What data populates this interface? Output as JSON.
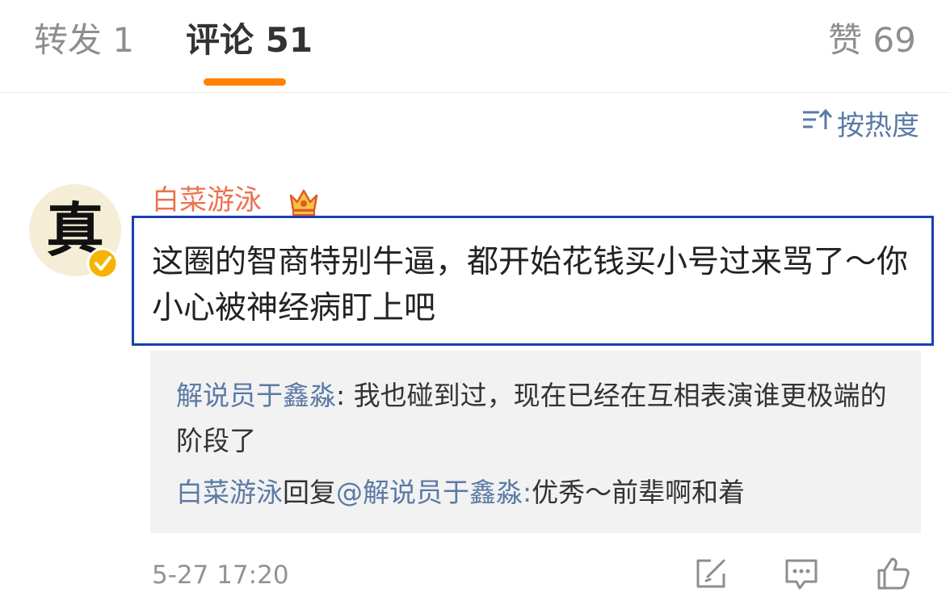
{
  "tabs": {
    "repost": "转发 1",
    "comments": "评论 51",
    "likes": "赞 69"
  },
  "sort": {
    "label": "按热度",
    "icon": "sort-icon"
  },
  "comment": {
    "avatar_text": "真",
    "username": "白菜游泳",
    "text": "这圈的智商特别牛逼，都开始花钱买小号过来骂了～你小心被神经病盯上吧",
    "timestamp": "5-27 17:20",
    "badges": [
      "verified-badge-icon",
      "crown-icon"
    ]
  },
  "replies": [
    {
      "author": "解说员于鑫淼",
      "separator": ":",
      "text": " 我也碰到过，现在已经在互相表演谁更极端的阶段了"
    },
    {
      "author": "白菜游泳",
      "action": "回复",
      "mention": "@解说员于鑫淼",
      "separator": ":",
      "text": "优秀～前辈啊和着"
    }
  ],
  "actions": [
    "share-icon",
    "comment-icon",
    "like-icon"
  ],
  "colors": {
    "accent": "#ff8200",
    "username": "#eb7350",
    "link": "#5b7aa5",
    "highlight_border": "#1a3fb0",
    "reply_bg": "#f2f2f2"
  }
}
